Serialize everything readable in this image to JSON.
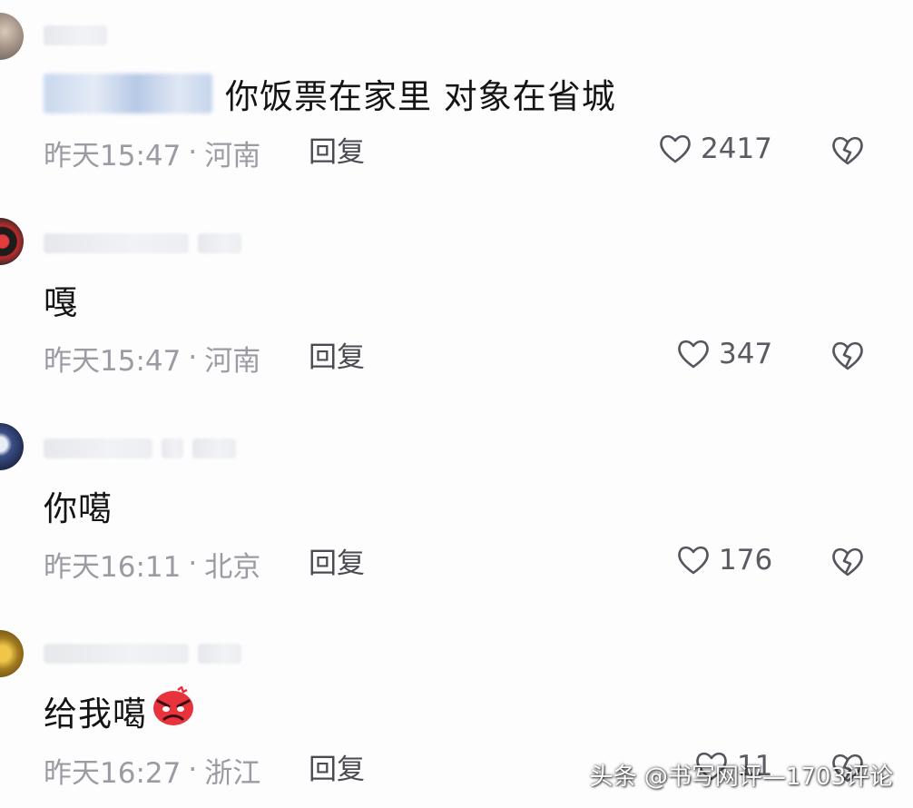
{
  "comments": [
    {
      "text": "你饭票在家里 对象在省城",
      "time": "昨天15:47",
      "location": "河南",
      "reply_label": "回复",
      "likes": "2417"
    },
    {
      "text": "嘎",
      "time": "昨天15:47",
      "location": "河南",
      "reply_label": "回复",
      "likes": "347"
    },
    {
      "text": "你噶",
      "time": "昨天16:11",
      "location": "北京",
      "reply_label": "回复",
      "likes": "176"
    },
    {
      "text": "给我噶",
      "time": "昨天16:27",
      "location": "浙江",
      "reply_label": "回复",
      "likes": "11"
    }
  ],
  "separator": "·",
  "watermark": "头条 @书写网评—1703评论",
  "icons": {
    "like": "heart-outline-icon",
    "dislike": "broken-heart-icon",
    "emoji": "angry-face-emoji"
  },
  "colors": {
    "meta_text": "#9b9ca3",
    "content_text": "#141414",
    "emoji_red": "#e8333c"
  }
}
